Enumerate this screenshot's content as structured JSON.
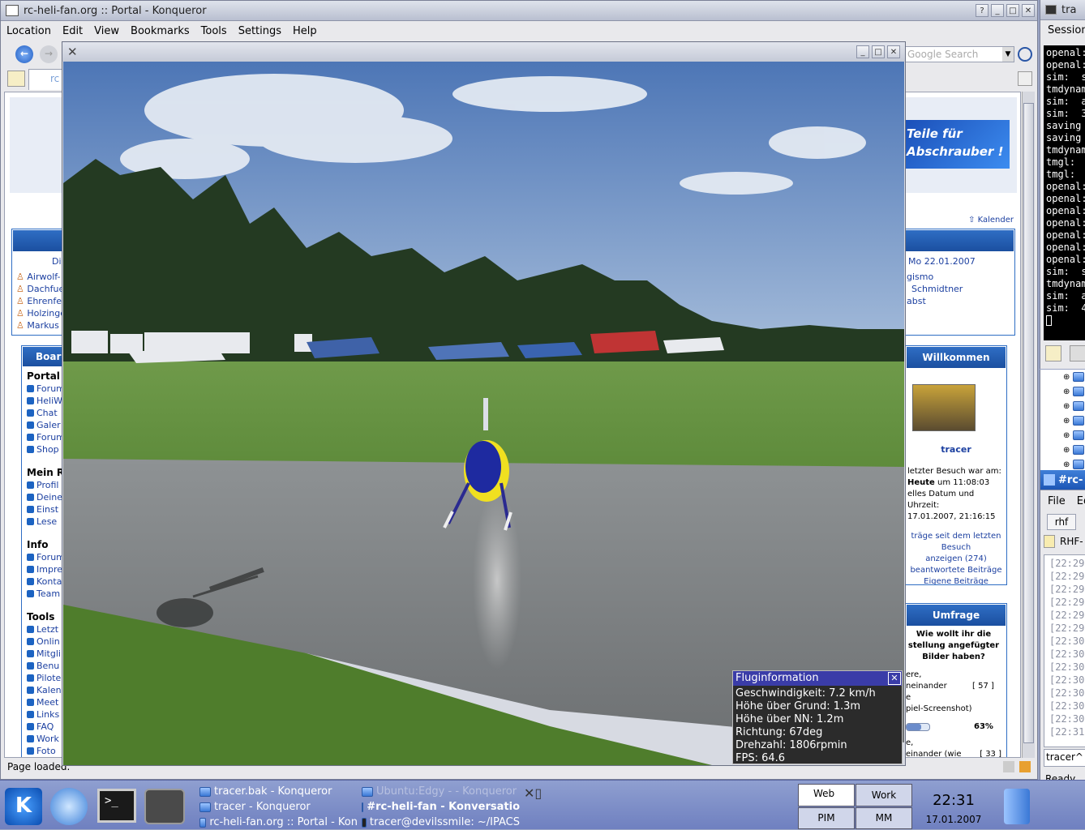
{
  "konqueror": {
    "title": "rc-heli-fan.org :: Portal - Konqueror",
    "menu": [
      "Location",
      "Edit",
      "View",
      "Bookmarks",
      "Tools",
      "Settings",
      "Help"
    ],
    "search_placeholder": "Google Search",
    "tab_label": "rc",
    "status": "Page loaded."
  },
  "page": {
    "banner_line1": "Teile für",
    "banner_line2": "Abschrauber !",
    "kalender_link": "Kalender",
    "date_text": "Mo 22.01.2007",
    "left_header": "Di",
    "users_left": [
      "Airwolf-",
      "Dachfue",
      "Ehrenfe",
      "Holzinge",
      "Markus"
    ],
    "users_right": [
      "gismo",
      "Schmidtner",
      "",
      "",
      "abst"
    ],
    "board_title": "Board",
    "sections": [
      {
        "title": "Portal",
        "items": [
          "Forum",
          "HeliW",
          "Chat",
          "Galer",
          "Forum",
          "Shop"
        ]
      },
      {
        "title": "Mein R",
        "items": [
          "Profil",
          "Deine",
          "Einst",
          "Lese"
        ]
      },
      {
        "title": "Info",
        "items": [
          "Forum",
          "Impre",
          "Konta",
          "Team"
        ]
      },
      {
        "title": "Tools",
        "items": [
          "Letzt",
          "Onlin",
          "Mitgli",
          "Benu",
          "Pilote",
          "Kalen",
          "Meet",
          "Links",
          "FAQ",
          "Work",
          "Foto"
        ]
      }
    ],
    "welcome": {
      "title": "Willkommen",
      "user": "tracer",
      "last_visit_label": "letzter Besuch war am:",
      "last_visit_day": "Heute",
      "last_visit_time": "um 11:08:03",
      "now_label": "elles Datum und Uhrzeit:",
      "now_value": "17.01.2007, 21:16:15",
      "links": [
        "träge seit dem letzten",
        "Besuch",
        "anzeigen (274)",
        "beantwortete Beiträge",
        "Eigene Beiträge"
      ]
    },
    "poll": {
      "title": "Umfrage",
      "question": "Wie wollt ihr die stellung angefügter Bilder haben?",
      "opt1_a": "ere,",
      "opt1_b": "neinander",
      "opt1_c": "e",
      "opt1_count": "[ 57 ]",
      "opt1_d": "piel-Screenshot)",
      "percent": "63%",
      "percent_value": 63,
      "opt2_a": "e,",
      "opt2_b": "einander (wie",
      "opt2_count": "[ 33 ]"
    }
  },
  "sim": {
    "finfo_title": "Fluginformation",
    "lines": [
      "Geschwindigkeit: 7.2 km/h",
      "Höhe über Grund: 1.3m",
      "Höhe über NN: 1.2m",
      "Richtung:  67deg",
      "Drehzahl: 1806rpmin",
      "FPS: 64.6"
    ]
  },
  "terminal": {
    "title": "tra",
    "menu": "Session",
    "lines": [
      "openal:",
      "openal:",
      "sim:  s",
      "tmdynam",
      "sim:  a",
      "sim:  3",
      "saving",
      "saving",
      "tmdynam",
      "tmgl:",
      "tmgl:",
      "openal:",
      "openal:",
      "openal:",
      "openal:",
      "openal:",
      "openal:",
      "openal:",
      "sim:  s",
      "tmdynam",
      "sim:  a",
      "sim:  4"
    ]
  },
  "chat": {
    "title": "#rc-",
    "menu": [
      "File",
      "Ed"
    ],
    "tab": "rhf",
    "label": "RHF-",
    "times": [
      "[22:29:",
      "[22:29:",
      "[22:29:",
      "[22:29:",
      "[22:29:",
      "[22:29:",
      "[22:30:",
      "[22:30:",
      "[22:30:",
      "[22:30:",
      "[22:30:",
      "[22:30:",
      "[22:30:",
      "[22:31:"
    ],
    "input": "tracer^",
    "status": "Ready."
  },
  "taskbar": {
    "tasks_col1": [
      "tracer.bak - Konqueror",
      "tracer - Konqueror",
      "rc-heli-fan.org :: Portal - Kon"
    ],
    "tasks_col2": [
      "Ubuntu:Edgy - - Konqueror",
      "#rc-heli-fan - Konversatio",
      "tracer@devilssmile: ~/IPACS"
    ],
    "desktops": [
      "Web",
      "Work",
      "PIM",
      "MM"
    ],
    "time": "22:31",
    "date": "17.01.2007"
  }
}
